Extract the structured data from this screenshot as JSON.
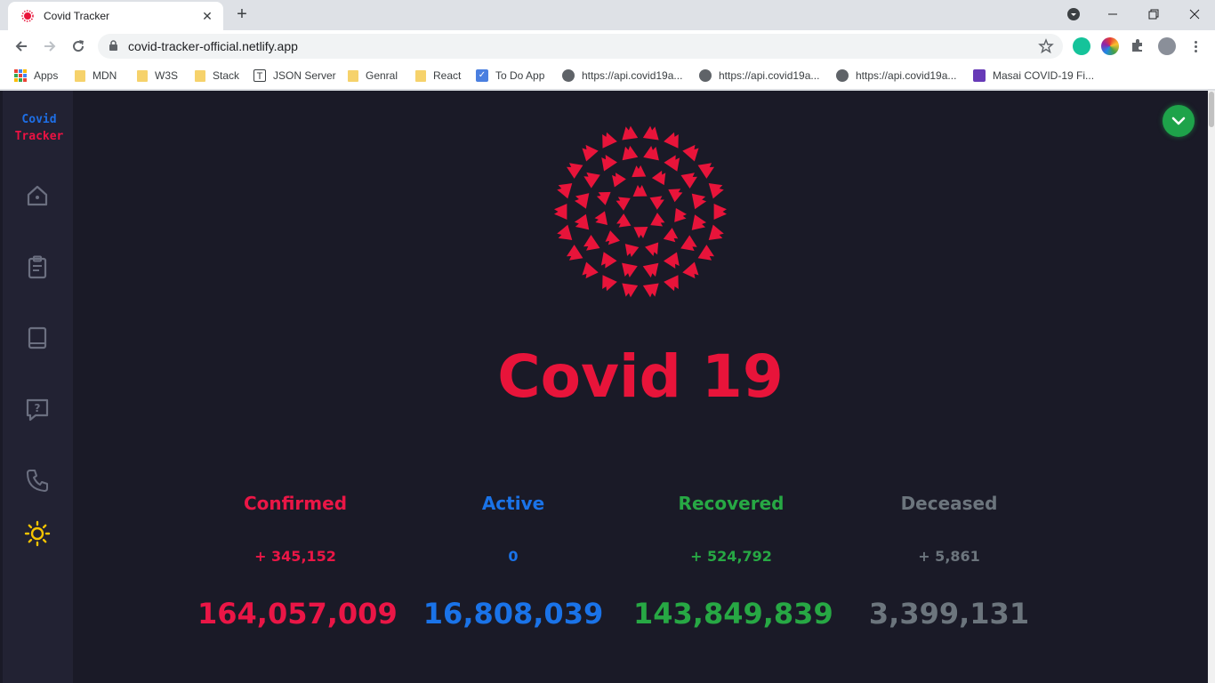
{
  "browser": {
    "tab_title": "Covid Tracker",
    "url": "covid-tracker-official.netlify.app",
    "bookmarks": [
      {
        "label": "Apps",
        "icon": "apps-grid-icon"
      },
      {
        "label": "MDN",
        "icon": "folder-icon"
      },
      {
        "label": "W3S",
        "icon": "folder-icon"
      },
      {
        "label": "Stack",
        "icon": "folder-icon"
      },
      {
        "label": "JSON Server",
        "icon": "json-icon"
      },
      {
        "label": "Genral",
        "icon": "folder-icon"
      },
      {
        "label": "React",
        "icon": "folder-icon"
      },
      {
        "label": "To Do App",
        "icon": "checkbox-icon"
      },
      {
        "label": "https://api.covid19a...",
        "icon": "globe-icon"
      },
      {
        "label": "https://api.covid19a...",
        "icon": "globe-icon"
      },
      {
        "label": "https://api.covid19a...",
        "icon": "globe-icon"
      },
      {
        "label": "Masai COVID-19 Fi...",
        "icon": "form-icon"
      }
    ]
  },
  "sidebar": {
    "brand_line1": "Covid",
    "brand_line2": "Tracker",
    "items": [
      "home-icon",
      "clipboard-icon",
      "book-icon",
      "help-icon",
      "phone-icon",
      "sun-icon"
    ]
  },
  "main": {
    "title": "Covid 19",
    "stats": [
      {
        "label": "Confirmed",
        "delta": "+ 345,152",
        "total": "164,057,009",
        "color": "#ea1646"
      },
      {
        "label": "Active",
        "delta": "0",
        "total": "16,808,039",
        "color": "#1a73e8"
      },
      {
        "label": "Recovered",
        "delta": "+ 524,792",
        "total": "143,849,839",
        "color": "#27a844"
      },
      {
        "label": "Deceased",
        "delta": "+ 5,861",
        "total": "3,399,131",
        "color": "#6c757d"
      }
    ]
  },
  "colors": {
    "page_bg": "#1a1a27",
    "sidebar_bg": "#222233",
    "accent_red": "#e8143a",
    "fab_green": "#1ea34a"
  }
}
